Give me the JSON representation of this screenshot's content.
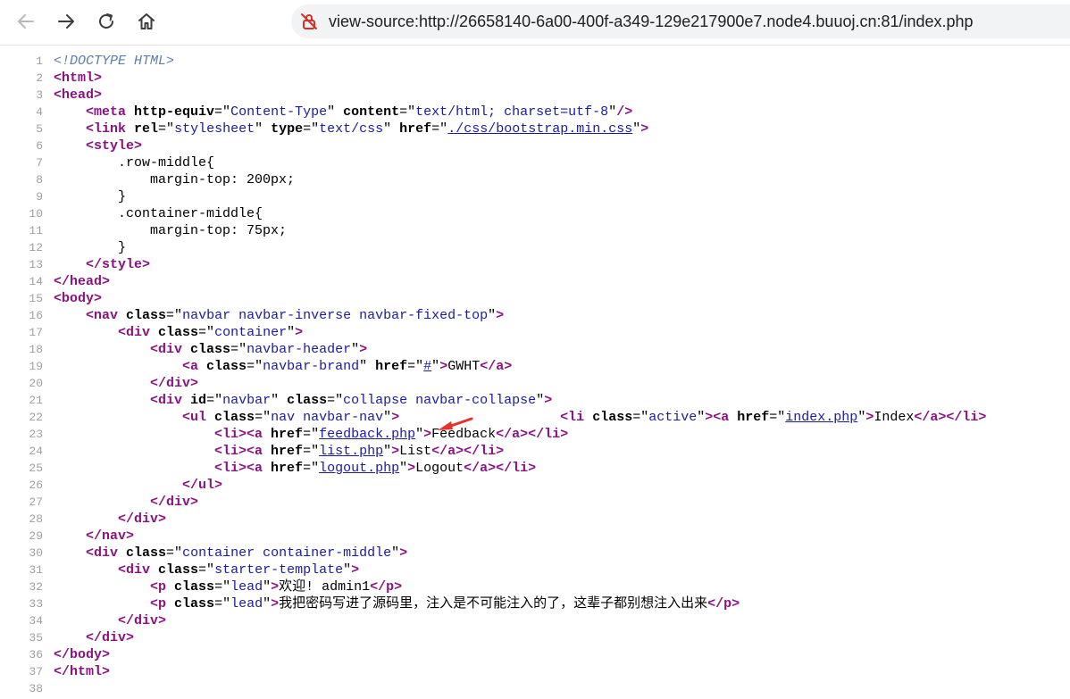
{
  "browser": {
    "url": "view-source:http://26658140-6a00-400f-a349-129e217900e7.node4.buuoj.cn:81/index.php",
    "icons": [
      "back-icon",
      "forward-icon",
      "reload-icon",
      "home-icon",
      "not-secure-icon"
    ]
  },
  "source_lines": [
    [
      [
        "dt",
        "<!DOCTYPE HTML>"
      ]
    ],
    [
      [
        "t",
        "<html>"
      ]
    ],
    [
      [
        "t",
        "<head>"
      ]
    ],
    [
      [
        "x",
        "    "
      ],
      [
        "t",
        "<meta "
      ],
      [
        "an",
        "http-equiv"
      ],
      [
        "x",
        "=\""
      ],
      [
        "av",
        "Content-Type"
      ],
      [
        "x",
        "\" "
      ],
      [
        "an",
        "content"
      ],
      [
        "x",
        "=\""
      ],
      [
        "av",
        "text/html; charset=utf-8"
      ],
      [
        "x",
        "\""
      ],
      [
        "t",
        "/>"
      ]
    ],
    [
      [
        "x",
        "    "
      ],
      [
        "t",
        "<link "
      ],
      [
        "an",
        "rel"
      ],
      [
        "x",
        "=\""
      ],
      [
        "av",
        "stylesheet"
      ],
      [
        "x",
        "\" "
      ],
      [
        "an",
        "type"
      ],
      [
        "x",
        "=\""
      ],
      [
        "av",
        "text/css"
      ],
      [
        "x",
        "\" "
      ],
      [
        "an",
        "href"
      ],
      [
        "x",
        "=\""
      ],
      [
        "lnk",
        "./css/bootstrap.min.css"
      ],
      [
        "x",
        "\""
      ],
      [
        "t",
        ">"
      ]
    ],
    [
      [
        "x",
        "    "
      ],
      [
        "t",
        "<style>"
      ]
    ],
    [
      [
        "x",
        "        .row-middle{"
      ]
    ],
    [
      [
        "x",
        "            margin-top: 200px;"
      ]
    ],
    [
      [
        "x",
        "        }"
      ]
    ],
    [
      [
        "x",
        "        .container-middle{"
      ]
    ],
    [
      [
        "x",
        "            margin-top: 75px;"
      ]
    ],
    [
      [
        "x",
        "        }"
      ]
    ],
    [
      [
        "x",
        "    "
      ],
      [
        "t",
        "</style>"
      ]
    ],
    [
      [
        "t",
        "</head>"
      ]
    ],
    [
      [
        "t",
        "<body>"
      ]
    ],
    [
      [
        "x",
        "    "
      ],
      [
        "t",
        "<nav "
      ],
      [
        "an",
        "class"
      ],
      [
        "x",
        "=\""
      ],
      [
        "av",
        "navbar navbar-inverse navbar-fixed-top"
      ],
      [
        "x",
        "\""
      ],
      [
        "t",
        ">"
      ]
    ],
    [
      [
        "x",
        "        "
      ],
      [
        "t",
        "<div "
      ],
      [
        "an",
        "class"
      ],
      [
        "x",
        "=\""
      ],
      [
        "av",
        "container"
      ],
      [
        "x",
        "\""
      ],
      [
        "t",
        ">"
      ]
    ],
    [
      [
        "x",
        "            "
      ],
      [
        "t",
        "<div "
      ],
      [
        "an",
        "class"
      ],
      [
        "x",
        "=\""
      ],
      [
        "av",
        "navbar-header"
      ],
      [
        "x",
        "\""
      ],
      [
        "t",
        ">"
      ]
    ],
    [
      [
        "x",
        "                "
      ],
      [
        "t",
        "<a "
      ],
      [
        "an",
        "class"
      ],
      [
        "x",
        "=\""
      ],
      [
        "av",
        "navbar-brand"
      ],
      [
        "x",
        "\" "
      ],
      [
        "an",
        "href"
      ],
      [
        "x",
        "=\""
      ],
      [
        "lnk",
        "#"
      ],
      [
        "x",
        "\""
      ],
      [
        "t",
        ">"
      ],
      [
        "x",
        "GWHT"
      ],
      [
        "t",
        "</a>"
      ]
    ],
    [
      [
        "x",
        "            "
      ],
      [
        "t",
        "</div>"
      ]
    ],
    [
      [
        "x",
        "            "
      ],
      [
        "t",
        "<div "
      ],
      [
        "an",
        "id"
      ],
      [
        "x",
        "=\""
      ],
      [
        "av",
        "navbar"
      ],
      [
        "x",
        "\" "
      ],
      [
        "an",
        "class"
      ],
      [
        "x",
        "=\""
      ],
      [
        "av",
        "collapse navbar-collapse"
      ],
      [
        "x",
        "\""
      ],
      [
        "t",
        ">"
      ]
    ],
    [
      [
        "x",
        "                "
      ],
      [
        "t",
        "<ul "
      ],
      [
        "an",
        "class"
      ],
      [
        "x",
        "=\""
      ],
      [
        "av",
        "nav navbar-nav"
      ],
      [
        "x",
        "\""
      ],
      [
        "t",
        ">"
      ],
      [
        "x",
        "                    "
      ],
      [
        "t",
        "<li "
      ],
      [
        "an",
        "class"
      ],
      [
        "x",
        "=\""
      ],
      [
        "av",
        "active"
      ],
      [
        "x",
        "\""
      ],
      [
        "t",
        "><a "
      ],
      [
        "an",
        "href"
      ],
      [
        "x",
        "=\""
      ],
      [
        "lnk",
        "index.php"
      ],
      [
        "x",
        "\""
      ],
      [
        "t",
        ">"
      ],
      [
        "x",
        "Index"
      ],
      [
        "t",
        "</a></li>"
      ]
    ],
    [
      [
        "x",
        "                    "
      ],
      [
        "t",
        "<li><a "
      ],
      [
        "an",
        "href"
      ],
      [
        "x",
        "=\""
      ],
      [
        "lnk",
        "feedback.php"
      ],
      [
        "x",
        "\""
      ],
      [
        "t",
        ">"
      ],
      [
        "x",
        "Feedback"
      ],
      [
        "t",
        "</a></li>"
      ]
    ],
    [
      [
        "x",
        "                    "
      ],
      [
        "t",
        "<li><a "
      ],
      [
        "an",
        "href"
      ],
      [
        "x",
        "=\""
      ],
      [
        "lnk",
        "list.php"
      ],
      [
        "x",
        "\""
      ],
      [
        "t",
        ">"
      ],
      [
        "x",
        "List"
      ],
      [
        "t",
        "</a></li>"
      ]
    ],
    [
      [
        "x",
        "                    "
      ],
      [
        "t",
        "<li><a "
      ],
      [
        "an",
        "href"
      ],
      [
        "x",
        "=\""
      ],
      [
        "lnk",
        "logout.php"
      ],
      [
        "x",
        "\""
      ],
      [
        "t",
        ">"
      ],
      [
        "x",
        "Logout"
      ],
      [
        "t",
        "</a></li>"
      ]
    ],
    [
      [
        "x",
        "                "
      ],
      [
        "t",
        "</ul>"
      ]
    ],
    [
      [
        "x",
        "            "
      ],
      [
        "t",
        "</div>"
      ]
    ],
    [
      [
        "x",
        "        "
      ],
      [
        "t",
        "</div>"
      ]
    ],
    [
      [
        "x",
        "    "
      ],
      [
        "t",
        "</nav>"
      ]
    ],
    [
      [
        "x",
        "    "
      ],
      [
        "t",
        "<div "
      ],
      [
        "an",
        "class"
      ],
      [
        "x",
        "=\""
      ],
      [
        "av",
        "container container-middle"
      ],
      [
        "x",
        "\""
      ],
      [
        "t",
        ">"
      ]
    ],
    [
      [
        "x",
        "        "
      ],
      [
        "t",
        "<div "
      ],
      [
        "an",
        "class"
      ],
      [
        "x",
        "=\""
      ],
      [
        "av",
        "starter-template"
      ],
      [
        "x",
        "\""
      ],
      [
        "t",
        ">"
      ]
    ],
    [
      [
        "x",
        "            "
      ],
      [
        "t",
        "<p "
      ],
      [
        "an",
        "class"
      ],
      [
        "x",
        "=\""
      ],
      [
        "av",
        "lead"
      ],
      [
        "x",
        "\""
      ],
      [
        "t",
        ">"
      ],
      [
        "x",
        "欢迎! admin1"
      ],
      [
        "t",
        "</p>"
      ]
    ],
    [
      [
        "x",
        "            "
      ],
      [
        "t",
        "<p "
      ],
      [
        "an",
        "class"
      ],
      [
        "x",
        "=\""
      ],
      [
        "av",
        "lead"
      ],
      [
        "x",
        "\""
      ],
      [
        "t",
        ">"
      ],
      [
        "x",
        "我把密码写进了源码里，注入是不可能注入的了，这辈子都别想注入出来"
      ],
      [
        "t",
        "</p>"
      ]
    ],
    [
      [
        "x",
        "        "
      ],
      [
        "t",
        "</div>"
      ]
    ],
    [
      [
        "x",
        "    "
      ],
      [
        "t",
        "</div>"
      ]
    ],
    [
      [
        "t",
        "</body>"
      ]
    ],
    [
      [
        "t",
        "</html>"
      ]
    ],
    []
  ],
  "annotation": {
    "icon": "red-arrow-icon",
    "color": "#e8312a"
  }
}
